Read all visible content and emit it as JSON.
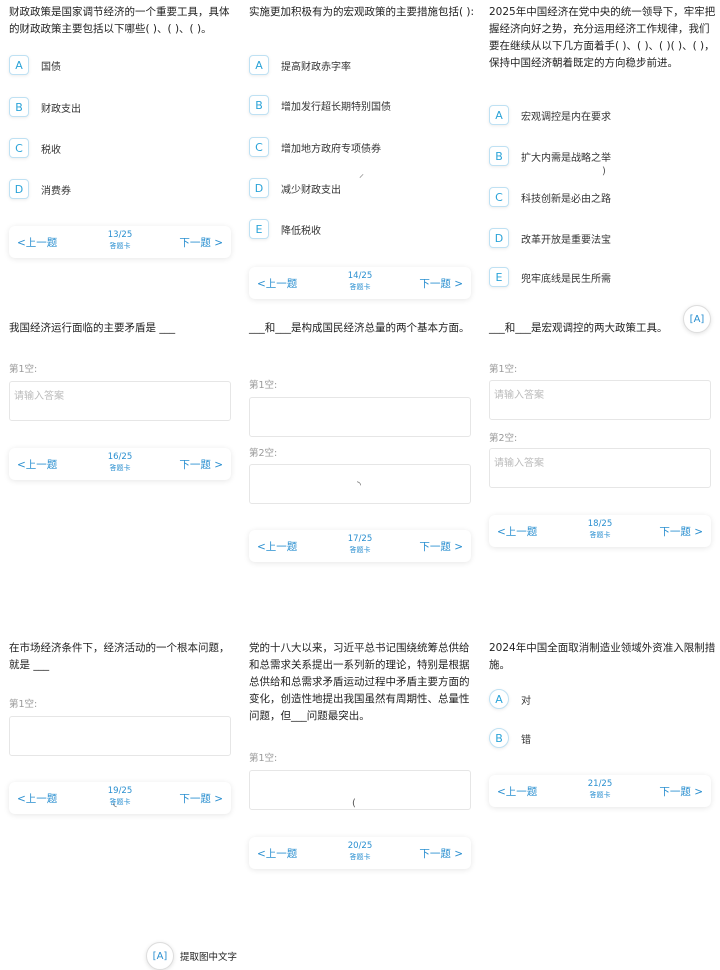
{
  "nav": {
    "prev": "<上一题",
    "next": "下一题 >",
    "answer_card": "答题卡"
  },
  "blank": {
    "placeholder": "请输入答案"
  },
  "q13": {
    "text": "财政政策是国家调节经济的一个重要工具，具体的财政政策主要包括以下哪些( )、( )、( )。",
    "options": [
      {
        "k": "A",
        "t": "国债"
      },
      {
        "k": "B",
        "t": "财政支出"
      },
      {
        "k": "C",
        "t": "税收"
      },
      {
        "k": "D",
        "t": "消费券"
      }
    ],
    "page": "13/25"
  },
  "q14": {
    "text": "实施更加积极有为的宏观政策的主要措施包括( ):",
    "options": [
      {
        "k": "A",
        "t": "提高财政赤字率"
      },
      {
        "k": "B",
        "t": "增加发行超长期特别国债"
      },
      {
        "k": "C",
        "t": "增加地方政府专项债券"
      },
      {
        "k": "D",
        "t": "减少财政支出"
      },
      {
        "k": "E",
        "t": "降低税收"
      }
    ],
    "page": "14/25"
  },
  "q15": {
    "text": "2025年中国经济在党中央的统一领导下，牢牢把握经济向好之势，充分运用经济工作规律，我们要在继续从以下几方面着手( )、( )、( )( )、( )，保持中国经济朝着既定的方向稳步前进。",
    "options": [
      {
        "k": "A",
        "t": "宏观调控是内在要求"
      },
      {
        "k": "B",
        "t": "扩大内需是战略之举"
      },
      {
        "k": "C",
        "t": "科技创新是必由之路"
      },
      {
        "k": "D",
        "t": "改革开放是重要法宝"
      },
      {
        "k": "E",
        "t": "兜牢底线是民生所需"
      }
    ]
  },
  "q16": {
    "text": "我国经济运行面临的主要矛盾是 ___",
    "blank1": "第1空:",
    "page": "16/25"
  },
  "q17": {
    "text": "___和___是构成国民经济总量的两个基本方面。",
    "blank1": "第1空:",
    "blank2": "第2空:",
    "page": "17/25"
  },
  "q18": {
    "text": "___和___是宏观调控的两大政策工具。",
    "blank1": "第1空:",
    "blank2": "第2空:",
    "page": "18/25"
  },
  "q19": {
    "text": "在市场经济条件下，经济活动的一个根本问题，就是 ___",
    "blank1": "第1空:",
    "page": "19/25"
  },
  "q20": {
    "text": "党的十八大以来，习近平总书记围绕统筹总供给和总需求关系提出一系列新的理论，特别是根据总供给和总需求矛盾运动过程中矛盾主要方面的变化，创造性地提出我国虽然有周期性、总量性问题，但___问题最突出。",
    "blank1": "第1空:",
    "page": "20/25"
  },
  "q21": {
    "text": "2024年中国全面取消制造业领域外资准入限制措施。",
    "options": [
      {
        "k": "A",
        "t": "对"
      },
      {
        "k": "B",
        "t": "错"
      }
    ],
    "page": "21/25"
  },
  "ocr": {
    "label": "提取图中文字"
  }
}
